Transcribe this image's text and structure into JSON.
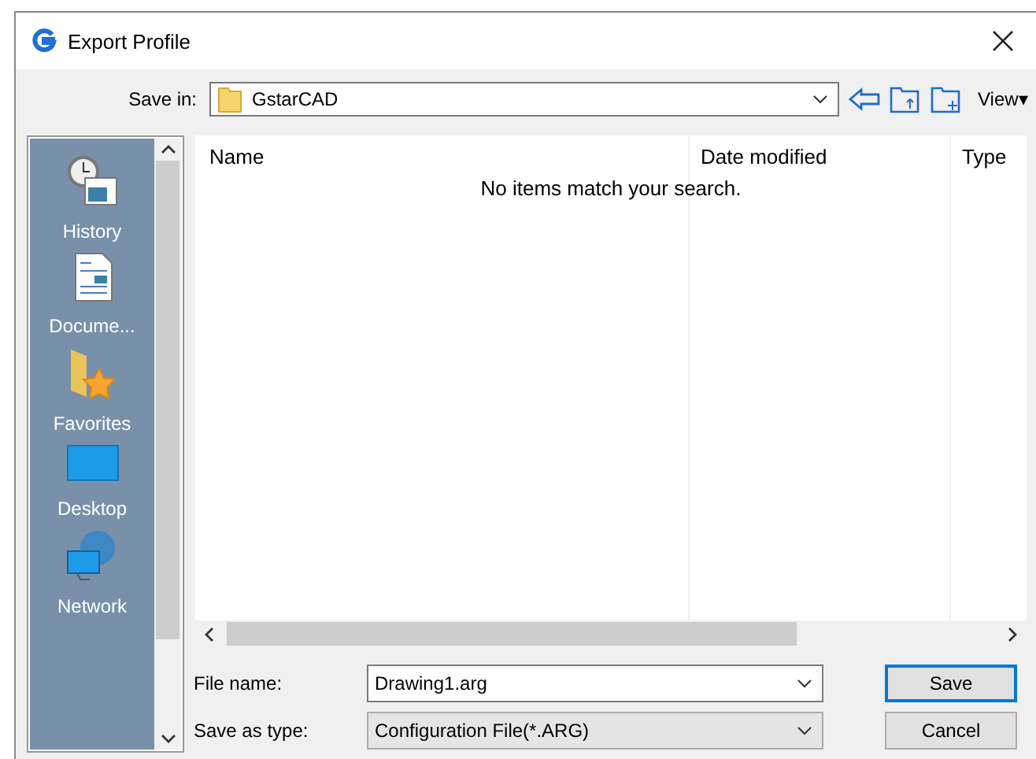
{
  "window": {
    "title": "Export Profile"
  },
  "save_in": {
    "label": "Save in:",
    "value": "GstarCAD",
    "view_label": "View▾"
  },
  "places": [
    {
      "label": "History",
      "kind": "history"
    },
    {
      "label": "Docume...",
      "kind": "document"
    },
    {
      "label": "Favorites",
      "kind": "favorites"
    },
    {
      "label": "Desktop",
      "kind": "desktop"
    },
    {
      "label": "Network",
      "kind": "network"
    }
  ],
  "file_list": {
    "columns": [
      "Name",
      "Date modified",
      "Type"
    ],
    "empty_message": "No items match your search."
  },
  "file_name": {
    "label": "File name:",
    "value": "Drawing1.arg"
  },
  "save_as_type": {
    "label": "Save as type:",
    "value": "Configuration File(*.ARG)"
  },
  "buttons": [
    {
      "label": "Save",
      "default": true
    },
    {
      "label": "Cancel",
      "default": false
    }
  ]
}
